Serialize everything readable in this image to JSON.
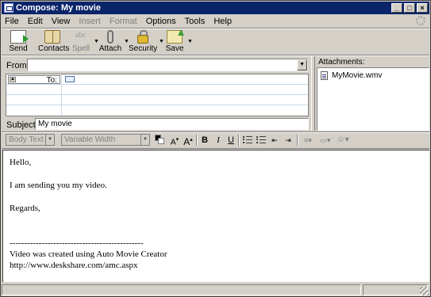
{
  "window": {
    "title": "Compose: My movie",
    "min": "_",
    "max": "□",
    "close": "×"
  },
  "menu": [
    {
      "label": "File",
      "enabled": true
    },
    {
      "label": "Edit",
      "enabled": true
    },
    {
      "label": "View",
      "enabled": true
    },
    {
      "label": "Insert",
      "enabled": false
    },
    {
      "label": "Format",
      "enabled": false
    },
    {
      "label": "Options",
      "enabled": true
    },
    {
      "label": "Tools",
      "enabled": true
    },
    {
      "label": "Help",
      "enabled": true
    }
  ],
  "toolbar": {
    "send": "Send",
    "contacts": "Contacts",
    "spell": "Spell",
    "spell_icon_text": "abc",
    "attach": "Attach",
    "security": "Security",
    "save": "Save"
  },
  "header": {
    "from_label": "From:",
    "from_value": "",
    "recipient_type": "To:",
    "subject_label": "Subject:",
    "subject_value": "My movie"
  },
  "attachments": {
    "label": "Attachments:",
    "items": [
      "MyMovie.wmv"
    ]
  },
  "format_bar": {
    "paragraph_style": "Body Text",
    "font": "Variable Width",
    "text_color": "#000000",
    "bg_color": "#ffffff",
    "smaller": "A",
    "larger": "A",
    "bold": "B",
    "italic": "I",
    "underline": "U"
  },
  "body": {
    "lines": [
      "Hello,",
      "",
      "I am sending you my video.",
      "",
      "Regards,",
      "",
      "",
      "----------------------------------------------",
      "Video was created using Auto Movie Creator",
      "http://www.deskshare.com/amc.aspx"
    ]
  }
}
